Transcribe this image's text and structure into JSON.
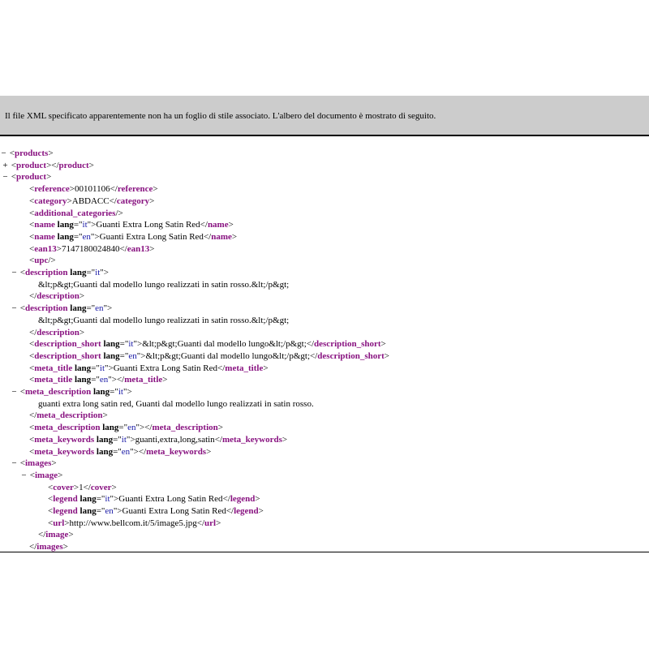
{
  "banner": {
    "message": "Il file XML specificato apparentemente non ha un foglio di stile associato. L'albero del documento è mostrato di seguito."
  },
  "tree": {
    "lines": [
      {
        "level": 0,
        "fold": "−",
        "parts": [
          {
            "t": "p",
            "v": "<"
          },
          {
            "t": "t",
            "v": "products"
          },
          {
            "t": "p",
            "v": ">"
          }
        ]
      },
      {
        "level": 1,
        "fold": "+",
        "parts": [
          {
            "t": "p",
            "v": "<"
          },
          {
            "t": "t",
            "v": "product"
          },
          {
            "t": "p",
            "v": "></"
          },
          {
            "t": "t",
            "v": "product"
          },
          {
            "t": "p",
            "v": ">"
          }
        ]
      },
      {
        "level": 1,
        "fold": "−",
        "parts": [
          {
            "t": "p",
            "v": "<"
          },
          {
            "t": "t",
            "v": "product"
          },
          {
            "t": "p",
            "v": ">"
          }
        ]
      },
      {
        "level": 3,
        "fold": "",
        "parts": [
          {
            "t": "p",
            "v": "<"
          },
          {
            "t": "t",
            "v": "reference"
          },
          {
            "t": "p",
            "v": ">"
          },
          {
            "t": "x",
            "v": "00101106"
          },
          {
            "t": "p",
            "v": "</"
          },
          {
            "t": "t",
            "v": "reference"
          },
          {
            "t": "p",
            "v": ">"
          }
        ]
      },
      {
        "level": 3,
        "fold": "",
        "parts": [
          {
            "t": "p",
            "v": "<"
          },
          {
            "t": "t",
            "v": "category"
          },
          {
            "t": "p",
            "v": ">"
          },
          {
            "t": "x",
            "v": "ABDACC"
          },
          {
            "t": "p",
            "v": "</"
          },
          {
            "t": "t",
            "v": "category"
          },
          {
            "t": "p",
            "v": ">"
          }
        ]
      },
      {
        "level": 3,
        "fold": "",
        "parts": [
          {
            "t": "p",
            "v": "<"
          },
          {
            "t": "t",
            "v": "additional_categories"
          },
          {
            "t": "p",
            "v": "/>"
          }
        ]
      },
      {
        "level": 3,
        "fold": "",
        "parts": [
          {
            "t": "p",
            "v": "<"
          },
          {
            "t": "t",
            "v": "name"
          },
          {
            "t": "p",
            "v": " "
          },
          {
            "t": "a",
            "v": "lang"
          },
          {
            "t": "p",
            "v": "=\""
          },
          {
            "t": "v",
            "v": "it"
          },
          {
            "t": "p",
            "v": "\">"
          },
          {
            "t": "x",
            "v": "Guanti Extra Long Satin Red"
          },
          {
            "t": "p",
            "v": "</"
          },
          {
            "t": "t",
            "v": "name"
          },
          {
            "t": "p",
            "v": ">"
          }
        ]
      },
      {
        "level": 3,
        "fold": "",
        "parts": [
          {
            "t": "p",
            "v": "<"
          },
          {
            "t": "t",
            "v": "name"
          },
          {
            "t": "p",
            "v": " "
          },
          {
            "t": "a",
            "v": "lang"
          },
          {
            "t": "p",
            "v": "=\""
          },
          {
            "t": "v",
            "v": "en"
          },
          {
            "t": "p",
            "v": "\">"
          },
          {
            "t": "x",
            "v": "Guanti Extra Long Satin Red"
          },
          {
            "t": "p",
            "v": "</"
          },
          {
            "t": "t",
            "v": "name"
          },
          {
            "t": "p",
            "v": ">"
          }
        ]
      },
      {
        "level": 3,
        "fold": "",
        "parts": [
          {
            "t": "p",
            "v": "<"
          },
          {
            "t": "t",
            "v": "ean13"
          },
          {
            "t": "p",
            "v": ">"
          },
          {
            "t": "x",
            "v": "7147180024840"
          },
          {
            "t": "p",
            "v": "</"
          },
          {
            "t": "t",
            "v": "ean13"
          },
          {
            "t": "p",
            "v": ">"
          }
        ]
      },
      {
        "level": 3,
        "fold": "",
        "parts": [
          {
            "t": "p",
            "v": "<"
          },
          {
            "t": "t",
            "v": "upc"
          },
          {
            "t": "p",
            "v": "/>"
          }
        ]
      },
      {
        "level": 2,
        "fold": "−",
        "parts": [
          {
            "t": "p",
            "v": "<"
          },
          {
            "t": "t",
            "v": "description"
          },
          {
            "t": "p",
            "v": " "
          },
          {
            "t": "a",
            "v": "lang"
          },
          {
            "t": "p",
            "v": "=\""
          },
          {
            "t": "v",
            "v": "it"
          },
          {
            "t": "p",
            "v": "\">"
          }
        ]
      },
      {
        "level": 4,
        "fold": "",
        "parts": [
          {
            "t": "x",
            "v": "&lt;p&gt;Guanti dal modello lungo realizzati in satin rosso.&lt;/p&gt;"
          }
        ]
      },
      {
        "level": 3,
        "fold": "",
        "parts": [
          {
            "t": "p",
            "v": "</"
          },
          {
            "t": "t",
            "v": "description"
          },
          {
            "t": "p",
            "v": ">"
          }
        ]
      },
      {
        "level": 2,
        "fold": "−",
        "parts": [
          {
            "t": "p",
            "v": "<"
          },
          {
            "t": "t",
            "v": "description"
          },
          {
            "t": "p",
            "v": " "
          },
          {
            "t": "a",
            "v": "lang"
          },
          {
            "t": "p",
            "v": "=\""
          },
          {
            "t": "v",
            "v": "en"
          },
          {
            "t": "p",
            "v": "\">"
          }
        ]
      },
      {
        "level": 4,
        "fold": "",
        "parts": [
          {
            "t": "x",
            "v": "&lt;p&gt;Guanti dal modello lungo realizzati in satin rosso.&lt;/p&gt;"
          }
        ]
      },
      {
        "level": 3,
        "fold": "",
        "parts": [
          {
            "t": "p",
            "v": "</"
          },
          {
            "t": "t",
            "v": "description"
          },
          {
            "t": "p",
            "v": ">"
          }
        ]
      },
      {
        "level": 3,
        "fold": "",
        "parts": [
          {
            "t": "p",
            "v": "<"
          },
          {
            "t": "t",
            "v": "description_short"
          },
          {
            "t": "p",
            "v": " "
          },
          {
            "t": "a",
            "v": "lang"
          },
          {
            "t": "p",
            "v": "=\""
          },
          {
            "t": "v",
            "v": "it"
          },
          {
            "t": "p",
            "v": "\">"
          },
          {
            "t": "x",
            "v": "&lt;p&gt;Guanti dal modello lungo&lt;/p&gt;"
          },
          {
            "t": "p",
            "v": "</"
          },
          {
            "t": "t",
            "v": "description_short"
          },
          {
            "t": "p",
            "v": ">"
          }
        ]
      },
      {
        "level": 3,
        "fold": "",
        "parts": [
          {
            "t": "p",
            "v": "<"
          },
          {
            "t": "t",
            "v": "description_short"
          },
          {
            "t": "p",
            "v": " "
          },
          {
            "t": "a",
            "v": "lang"
          },
          {
            "t": "p",
            "v": "=\""
          },
          {
            "t": "v",
            "v": "en"
          },
          {
            "t": "p",
            "v": "\">"
          },
          {
            "t": "x",
            "v": "&lt;p&gt;Guanti dal modello lungo&lt;/p&gt;"
          },
          {
            "t": "p",
            "v": "</"
          },
          {
            "t": "t",
            "v": "description_short"
          },
          {
            "t": "p",
            "v": ">"
          }
        ]
      },
      {
        "level": 3,
        "fold": "",
        "parts": [
          {
            "t": "p",
            "v": "<"
          },
          {
            "t": "t",
            "v": "meta_title"
          },
          {
            "t": "p",
            "v": " "
          },
          {
            "t": "a",
            "v": "lang"
          },
          {
            "t": "p",
            "v": "=\""
          },
          {
            "t": "v",
            "v": "it"
          },
          {
            "t": "p",
            "v": "\">"
          },
          {
            "t": "x",
            "v": "Guanti Extra Long Satin Red"
          },
          {
            "t": "p",
            "v": "</"
          },
          {
            "t": "t",
            "v": "meta_title"
          },
          {
            "t": "p",
            "v": ">"
          }
        ]
      },
      {
        "level": 3,
        "fold": "",
        "parts": [
          {
            "t": "p",
            "v": "<"
          },
          {
            "t": "t",
            "v": "meta_title"
          },
          {
            "t": "p",
            "v": " "
          },
          {
            "t": "a",
            "v": "lang"
          },
          {
            "t": "p",
            "v": "=\""
          },
          {
            "t": "v",
            "v": "en"
          },
          {
            "t": "p",
            "v": "\"></"
          },
          {
            "t": "t",
            "v": "meta_title"
          },
          {
            "t": "p",
            "v": ">"
          }
        ]
      },
      {
        "level": 2,
        "fold": "−",
        "parts": [
          {
            "t": "p",
            "v": "<"
          },
          {
            "t": "t",
            "v": "meta_description"
          },
          {
            "t": "p",
            "v": " "
          },
          {
            "t": "a",
            "v": "lang"
          },
          {
            "t": "p",
            "v": "=\""
          },
          {
            "t": "v",
            "v": "it"
          },
          {
            "t": "p",
            "v": "\">"
          }
        ]
      },
      {
        "level": 4,
        "fold": "",
        "parts": [
          {
            "t": "x",
            "v": "guanti extra long satin red, Guanti dal modello lungo realizzati in satin rosso."
          }
        ]
      },
      {
        "level": 3,
        "fold": "",
        "parts": [
          {
            "t": "p",
            "v": "</"
          },
          {
            "t": "t",
            "v": "meta_description"
          },
          {
            "t": "p",
            "v": ">"
          }
        ]
      },
      {
        "level": 3,
        "fold": "",
        "parts": [
          {
            "t": "p",
            "v": "<"
          },
          {
            "t": "t",
            "v": "meta_description"
          },
          {
            "t": "p",
            "v": " "
          },
          {
            "t": "a",
            "v": "lang"
          },
          {
            "t": "p",
            "v": "=\""
          },
          {
            "t": "v",
            "v": "en"
          },
          {
            "t": "p",
            "v": "\"></"
          },
          {
            "t": "t",
            "v": "meta_description"
          },
          {
            "t": "p",
            "v": ">"
          }
        ]
      },
      {
        "level": 3,
        "fold": "",
        "parts": [
          {
            "t": "p",
            "v": "<"
          },
          {
            "t": "t",
            "v": "meta_keywords"
          },
          {
            "t": "p",
            "v": " "
          },
          {
            "t": "a",
            "v": "lang"
          },
          {
            "t": "p",
            "v": "=\""
          },
          {
            "t": "v",
            "v": "it"
          },
          {
            "t": "p",
            "v": "\">"
          },
          {
            "t": "x",
            "v": "guanti,extra,long,satin"
          },
          {
            "t": "p",
            "v": "</"
          },
          {
            "t": "t",
            "v": "meta_keywords"
          },
          {
            "t": "p",
            "v": ">"
          }
        ]
      },
      {
        "level": 3,
        "fold": "",
        "parts": [
          {
            "t": "p",
            "v": "<"
          },
          {
            "t": "t",
            "v": "meta_keywords"
          },
          {
            "t": "p",
            "v": " "
          },
          {
            "t": "a",
            "v": "lang"
          },
          {
            "t": "p",
            "v": "=\""
          },
          {
            "t": "v",
            "v": "en"
          },
          {
            "t": "p",
            "v": "\"></"
          },
          {
            "t": "t",
            "v": "meta_keywords"
          },
          {
            "t": "p",
            "v": ">"
          }
        ]
      },
      {
        "level": 2,
        "fold": "−",
        "parts": [
          {
            "t": "p",
            "v": "<"
          },
          {
            "t": "t",
            "v": "images"
          },
          {
            "t": "p",
            "v": ">"
          }
        ]
      },
      {
        "level": 3,
        "fold": "−",
        "parts": [
          {
            "t": "p",
            "v": "<"
          },
          {
            "t": "t",
            "v": "image"
          },
          {
            "t": "p",
            "v": ">"
          }
        ]
      },
      {
        "level": 5,
        "fold": "",
        "parts": [
          {
            "t": "p",
            "v": "<"
          },
          {
            "t": "t",
            "v": "cover"
          },
          {
            "t": "p",
            "v": ">"
          },
          {
            "t": "x",
            "v": "1"
          },
          {
            "t": "p",
            "v": "</"
          },
          {
            "t": "t",
            "v": "cover"
          },
          {
            "t": "p",
            "v": ">"
          }
        ]
      },
      {
        "level": 5,
        "fold": "",
        "parts": [
          {
            "t": "p",
            "v": "<"
          },
          {
            "t": "t",
            "v": "legend"
          },
          {
            "t": "p",
            "v": " "
          },
          {
            "t": "a",
            "v": "lang"
          },
          {
            "t": "p",
            "v": "=\""
          },
          {
            "t": "v",
            "v": "it"
          },
          {
            "t": "p",
            "v": "\">"
          },
          {
            "t": "x",
            "v": "Guanti Extra Long Satin Red"
          },
          {
            "t": "p",
            "v": "</"
          },
          {
            "t": "t",
            "v": "legend"
          },
          {
            "t": "p",
            "v": ">"
          }
        ]
      },
      {
        "level": 5,
        "fold": "",
        "parts": [
          {
            "t": "p",
            "v": "<"
          },
          {
            "t": "t",
            "v": "legend"
          },
          {
            "t": "p",
            "v": " "
          },
          {
            "t": "a",
            "v": "lang"
          },
          {
            "t": "p",
            "v": "=\""
          },
          {
            "t": "v",
            "v": "en"
          },
          {
            "t": "p",
            "v": "\">"
          },
          {
            "t": "x",
            "v": "Guanti Extra Long Satin Red"
          },
          {
            "t": "p",
            "v": "</"
          },
          {
            "t": "t",
            "v": "legend"
          },
          {
            "t": "p",
            "v": ">"
          }
        ]
      },
      {
        "level": 5,
        "fold": "",
        "parts": [
          {
            "t": "p",
            "v": "<"
          },
          {
            "t": "t",
            "v": "url"
          },
          {
            "t": "p",
            "v": ">"
          },
          {
            "t": "x",
            "v": "http://www.bellcom.it/5/image5.jpg"
          },
          {
            "t": "p",
            "v": "</"
          },
          {
            "t": "t",
            "v": "url"
          },
          {
            "t": "p",
            "v": ">"
          }
        ]
      },
      {
        "level": 4,
        "fold": "",
        "parts": [
          {
            "t": "p",
            "v": "</"
          },
          {
            "t": "t",
            "v": "image"
          },
          {
            "t": "p",
            "v": ">"
          }
        ]
      },
      {
        "level": 3,
        "fold": "",
        "parts": [
          {
            "t": "p",
            "v": "</"
          },
          {
            "t": "t",
            "v": "images"
          },
          {
            "t": "p",
            "v": ">"
          }
        ]
      }
    ]
  }
}
